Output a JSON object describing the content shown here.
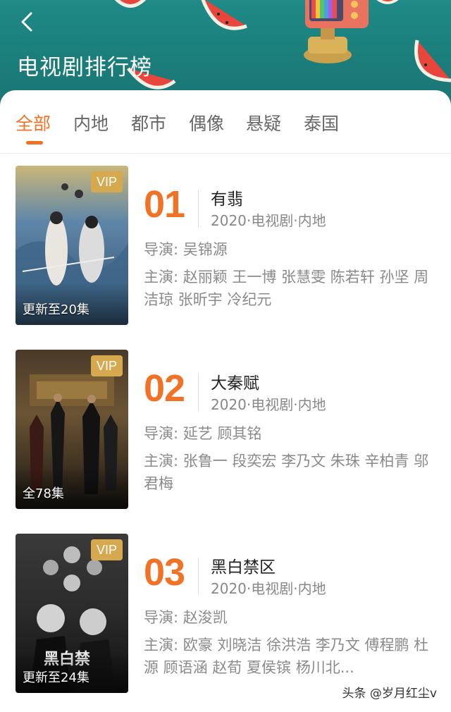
{
  "header": {
    "title": "电视剧排行榜",
    "back_icon": "chevron-left-icon",
    "background_color": "#1b7d7a"
  },
  "tabs": [
    {
      "label": "全部",
      "active": true
    },
    {
      "label": "内地",
      "active": false
    },
    {
      "label": "都市",
      "active": false
    },
    {
      "label": "偶像",
      "active": false
    },
    {
      "label": "悬疑",
      "active": false
    },
    {
      "label": "泰国",
      "active": false
    }
  ],
  "accent_color": "#f07227",
  "items": [
    {
      "rank": "01",
      "title": "有翡",
      "meta": "2020·电视剧·内地",
      "director": "导演: 吴锦源",
      "cast": "主演: 赵丽颖 王一博 张慧雯 陈若轩 孙坚 周洁琼 张昕宇 冷纪元",
      "badge": "VIP",
      "episodes": "更新至20集"
    },
    {
      "rank": "02",
      "title": "大秦赋",
      "meta": "2020·电视剧·内地",
      "director": "导演: 延艺 顾其铭",
      "cast": "主演: 张鲁一 段奕宏 李乃文 朱珠 辛柏青 邬君梅",
      "badge": "VIP",
      "episodes": "全78集"
    },
    {
      "rank": "03",
      "title": "黑白禁区",
      "meta": "2020·电视剧·内地",
      "director": "导演: 赵浚凯",
      "cast": "主演: 欧豪 刘晓洁 徐洪浩 李乃文 傅程鹏 杜源 顾语涵 赵荀 夏侯镔 杨川北...",
      "badge": "VIP",
      "episodes": "更新至24集"
    }
  ],
  "watermark": "头条 @岁月红尘v"
}
